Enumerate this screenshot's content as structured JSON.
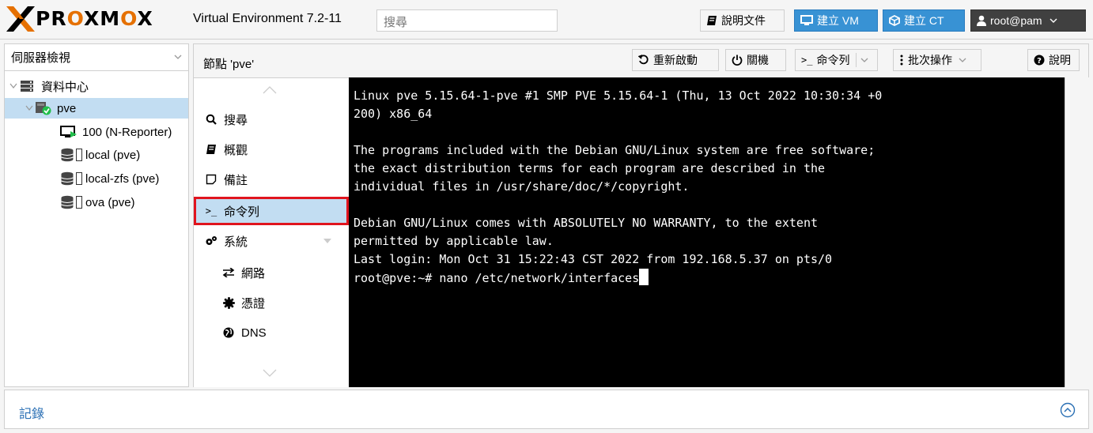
{
  "header": {
    "logo_text": "PROXMOX",
    "version": "Virtual Environment 7.2-11",
    "search_placeholder": "搜尋",
    "docs_label": "說明文件",
    "create_vm_label": "建立 VM",
    "create_ct_label": "建立 CT",
    "user_label": "root@pam"
  },
  "tree": {
    "view_label": "伺服器檢視",
    "items": [
      {
        "label": "資料中心",
        "icon": "datacenter-icon"
      },
      {
        "label": "pve",
        "icon": "node-online-icon"
      },
      {
        "label": "100 (N-Reporter)",
        "icon": "vm-running-icon"
      },
      {
        "label": "local (pve)",
        "icon": "storage-icon"
      },
      {
        "label": "local-zfs (pve)",
        "icon": "storage-icon"
      },
      {
        "label": "ova (pve)",
        "icon": "storage-icon"
      }
    ]
  },
  "node": {
    "title": "節點 'pve'",
    "reboot_label": "重新啟動",
    "shutdown_label": "關機",
    "shell_label": "命令列",
    "bulk_label": "批次操作",
    "help_label": "說明"
  },
  "menu": {
    "items": [
      {
        "label": "搜尋",
        "icon": "search-icon"
      },
      {
        "label": "概觀",
        "icon": "book-icon"
      },
      {
        "label": "備註",
        "icon": "note-icon"
      },
      {
        "label": "命令列",
        "icon": "terminal-icon"
      },
      {
        "label": "系統",
        "icon": "gears-icon"
      },
      {
        "label": "網路",
        "icon": "exchange-icon"
      },
      {
        "label": "憑證",
        "icon": "certificate-icon"
      },
      {
        "label": "DNS",
        "icon": "globe-icon"
      }
    ]
  },
  "terminal": {
    "lines": [
      "Linux pve 5.15.64-1-pve #1 SMP PVE 5.15.64-1 (Thu, 13 Oct 2022 10:30:34 +0",
      "200) x86_64",
      "",
      "The programs included with the Debian GNU/Linux system are free software;",
      "the exact distribution terms for each program are described in the",
      "individual files in /usr/share/doc/*/copyright.",
      "",
      "Debian GNU/Linux comes with ABSOLUTELY NO WARRANTY, to the extent",
      "permitted by applicable law.",
      "Last login: Mon Oct 31 15:22:43 CST 2022 from 192.168.5.37 on pts/0",
      "root@pve:~# nano /etc/network/interfaces"
    ]
  },
  "log": {
    "title": "記錄"
  },
  "colors": {
    "accent": "#3892d4",
    "brand_orange": "#e57000",
    "selection": "#c2ddf2",
    "highlight_border": "#e0141e"
  }
}
